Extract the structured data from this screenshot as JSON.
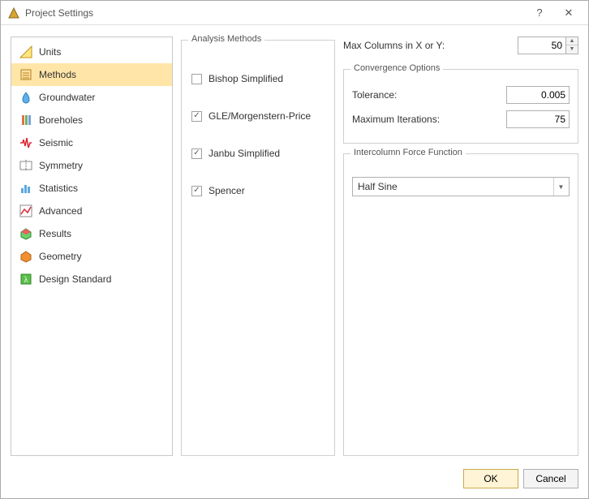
{
  "window": {
    "title": "Project Settings"
  },
  "sidebar": {
    "items": [
      {
        "label": "Units",
        "icon": "units-icon",
        "selected": false
      },
      {
        "label": "Methods",
        "icon": "methods-icon",
        "selected": true
      },
      {
        "label": "Groundwater",
        "icon": "groundwater-icon",
        "selected": false
      },
      {
        "label": "Boreholes",
        "icon": "boreholes-icon",
        "selected": false
      },
      {
        "label": "Seismic",
        "icon": "seismic-icon",
        "selected": false
      },
      {
        "label": "Symmetry",
        "icon": "symmetry-icon",
        "selected": false
      },
      {
        "label": "Statistics",
        "icon": "statistics-icon",
        "selected": false
      },
      {
        "label": "Advanced",
        "icon": "advanced-icon",
        "selected": false
      },
      {
        "label": "Results",
        "icon": "results-icon",
        "selected": false
      },
      {
        "label": "Geometry",
        "icon": "geometry-icon",
        "selected": false
      },
      {
        "label": "Design Standard",
        "icon": "design-standard-icon",
        "selected": false
      }
    ]
  },
  "analysis_methods": {
    "legend": "Analysis Methods",
    "items": [
      {
        "label": "Bishop Simplified",
        "checked": false
      },
      {
        "label": "GLE/Morgenstern-Price",
        "checked": true
      },
      {
        "label": "Janbu Simplified",
        "checked": true
      },
      {
        "label": "Spencer",
        "checked": true
      }
    ]
  },
  "max_columns": {
    "label": "Max Columns in X or Y:",
    "value": "50"
  },
  "convergence": {
    "legend": "Convergence Options",
    "tolerance_label": "Tolerance:",
    "tolerance_value": "0.005",
    "max_iter_label": "Maximum Iterations:",
    "max_iter_value": "75"
  },
  "intercolumn": {
    "legend": "Intercolumn Force Function",
    "selected": "Half Sine"
  },
  "footer": {
    "ok": "OK",
    "cancel": "Cancel"
  }
}
